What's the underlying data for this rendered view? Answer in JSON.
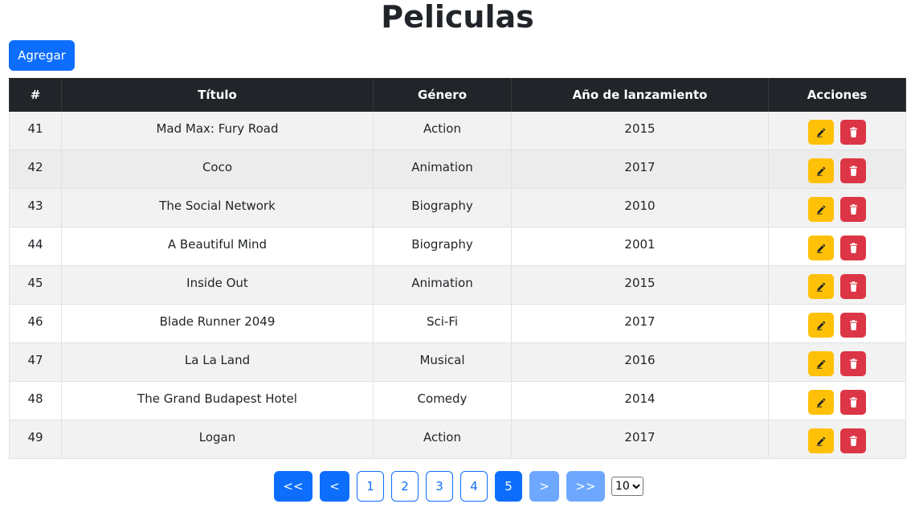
{
  "page": {
    "title": "Peliculas"
  },
  "toolbar": {
    "add_label": "Agregar"
  },
  "table": {
    "headers": [
      "#",
      "Título",
      "Género",
      "Año de lanzamiento",
      "Acciones"
    ],
    "rows": [
      {
        "id": "41",
        "title": "Mad Max: Fury Road",
        "genre": "Action",
        "year": "2015"
      },
      {
        "id": "42",
        "title": "Coco",
        "genre": "Animation",
        "year": "2017"
      },
      {
        "id": "43",
        "title": "The Social Network",
        "genre": "Biography",
        "year": "2010"
      },
      {
        "id": "44",
        "title": "A Beautiful Mind",
        "genre": "Biography",
        "year": "2001"
      },
      {
        "id": "45",
        "title": "Inside Out",
        "genre": "Animation",
        "year": "2015"
      },
      {
        "id": "46",
        "title": "Blade Runner 2049",
        "genre": "Sci-Fi",
        "year": "2017"
      },
      {
        "id": "47",
        "title": "La La Land",
        "genre": "Musical",
        "year": "2016"
      },
      {
        "id": "48",
        "title": "The Grand Budapest Hotel",
        "genre": "Comedy",
        "year": "2014"
      },
      {
        "id": "49",
        "title": "Logan",
        "genre": "Action",
        "year": "2017"
      }
    ],
    "actions": {
      "edit_icon": "edit-icon",
      "delete_icon": "trash-icon"
    }
  },
  "pagination": {
    "first_label": "<<",
    "prev_label": "<",
    "pages": [
      "1",
      "2",
      "3",
      "4",
      "5"
    ],
    "current_page": "5",
    "next_label": ">",
    "last_label": ">>",
    "page_size": "10"
  },
  "colors": {
    "primary": "#0d6efd",
    "primary_disabled": "#6ea8fe",
    "warning": "#ffc107",
    "danger": "#dc3545",
    "header_dark": "#212529"
  }
}
